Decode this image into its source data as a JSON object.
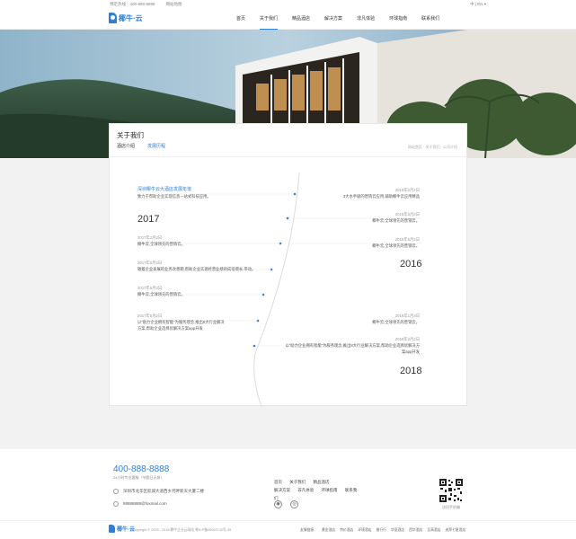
{
  "topbar": {
    "hotline": "预定热线：400-888-8888",
    "online": "网站地图",
    "right": "中 | EN ▾"
  },
  "logo": {
    "text": "椰牛·云"
  },
  "nav": [
    "首页",
    "关于我们",
    "精品酒店",
    "解决方案",
    "非凡体验",
    "环球指南",
    "联系我们"
  ],
  "page": {
    "title": "关于我们",
    "tabs": [
      "酒店介绍",
      "发展历程"
    ],
    "breadcrumb": "网站首页 · 关于我们 · 公司介绍"
  },
  "timeline": {
    "left": [
      {
        "date": "",
        "title": "深圳椰牛云大酒店发展年谱",
        "text": "致力于帮助企业实现信息一站式科技应用。"
      },
      {
        "date": "2017年2月2日",
        "title": "",
        "text": "椰牛云,全球领先的营销云。"
      },
      {
        "date": "2017年5月2日",
        "title": "",
        "text": "随着企业发展的业务改善期,帮助企业实现经营业绩的成倍增长,带动。"
      },
      {
        "date": "2017年5月2日",
        "title": "",
        "text": "椰牛云,全球领先的营销云。"
      },
      {
        "date": "2017年5月2日",
        "title": "",
        "text": "以“助力企业拥有智能”为服务理念,推出8大行业解决方案,帮助企业选择优解决方案app开发"
      }
    ],
    "right": [
      {
        "date": "2016年2月2日",
        "text": "3大水手级的营销云应用,辅助椰牛云应用精品"
      },
      {
        "date": "2016年5月2日",
        "text": "椰牛云,全球领先的营销云。"
      },
      {
        "date": "2016年5月2日",
        "text": "椰牛云,全球领先的营销云。"
      },
      {
        "date": "2018年1月3日",
        "text": "椰牛云,全球领先的营销云。"
      },
      {
        "date": "2018年2月2日",
        "text": "以“助力企业拥有智能”为服务理念,推出8大行业解决方案,帮助企业选择优解决方案app开发"
      }
    ],
    "years": [
      "2017",
      "2016",
      "2018"
    ]
  },
  "footer": {
    "phone": "400-888-8888",
    "hours": "24小时专业客服（节假日无休）",
    "address": "深圳市龙华区航城大道西乡河畔新天大厦二楼",
    "email": "88888888@foxmail.com",
    "links": [
      "首页",
      "关于我们",
      "精品酒店",
      "解决方案",
      "非凡体验",
      "环球指南",
      "联系我们"
    ],
    "qr_label": "访问手机端"
  },
  "bottom": {
    "copy": "Copyright © 2009 - 2018 椰牛企业云网站 粤ICP备09063742号-35",
    "links": [
      "友情链接：",
      "黄金酒店",
      "特价酒店",
      "环境酒店",
      "推行行",
      "华夏酒店",
      "西华酒店",
      "至高酒店",
      "迪拜七星酒店"
    ]
  },
  "colors": {
    "accent": "#2f7fd6"
  }
}
